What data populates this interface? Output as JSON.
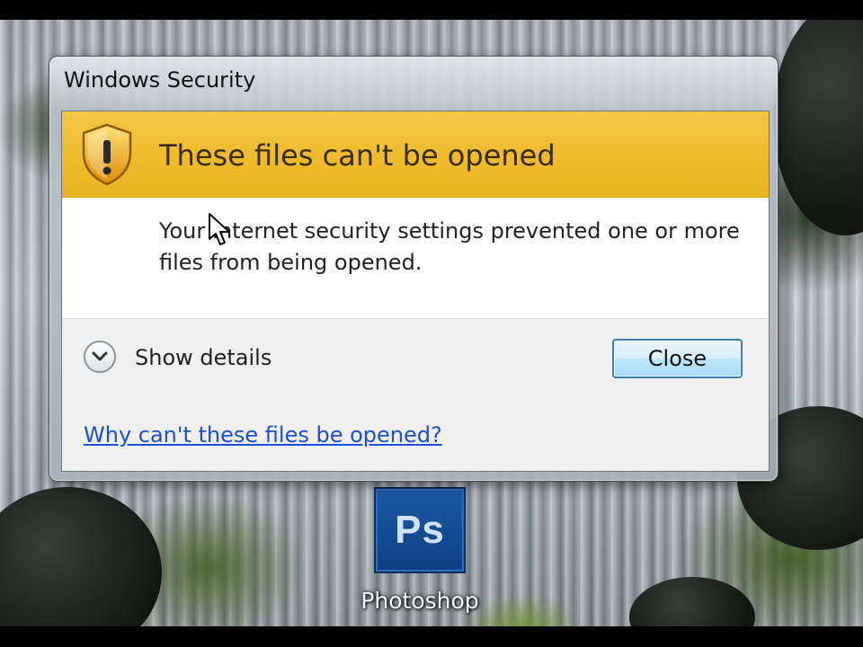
{
  "window": {
    "title": "Windows Security"
  },
  "banner": {
    "heading": "These files can't be opened",
    "icon": "shield-warning-icon",
    "color": "#f0bc2c"
  },
  "message": "Your Internet security settings prevented one or more files from being opened.",
  "details": {
    "toggle_label": "Show details",
    "icon": "chevron-down-icon"
  },
  "buttons": {
    "close_label": "Close"
  },
  "help": {
    "link_text": "Why can't these files be opened?",
    "link_color": "#1b4fd6"
  },
  "desktop": {
    "icon_label": "Photoshop",
    "icon_text": "Ps"
  }
}
